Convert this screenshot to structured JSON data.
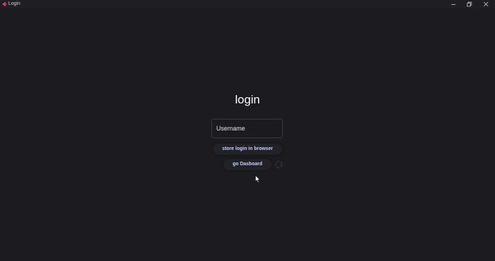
{
  "window": {
    "title": "Login",
    "icons": {
      "app": "app-logo-icon",
      "minimize": "minimize-icon",
      "restore": "restore-icon",
      "close": "close-icon"
    }
  },
  "login": {
    "heading": "login",
    "username_placeholder": "Username",
    "username_value": "",
    "store_button_label": "store login in browser",
    "dashboard_button_label": "go Dasboard"
  },
  "colors": {
    "background": "#1c1b1f",
    "button_text": "#c8d2ff",
    "app_icon": "#e8357f"
  }
}
